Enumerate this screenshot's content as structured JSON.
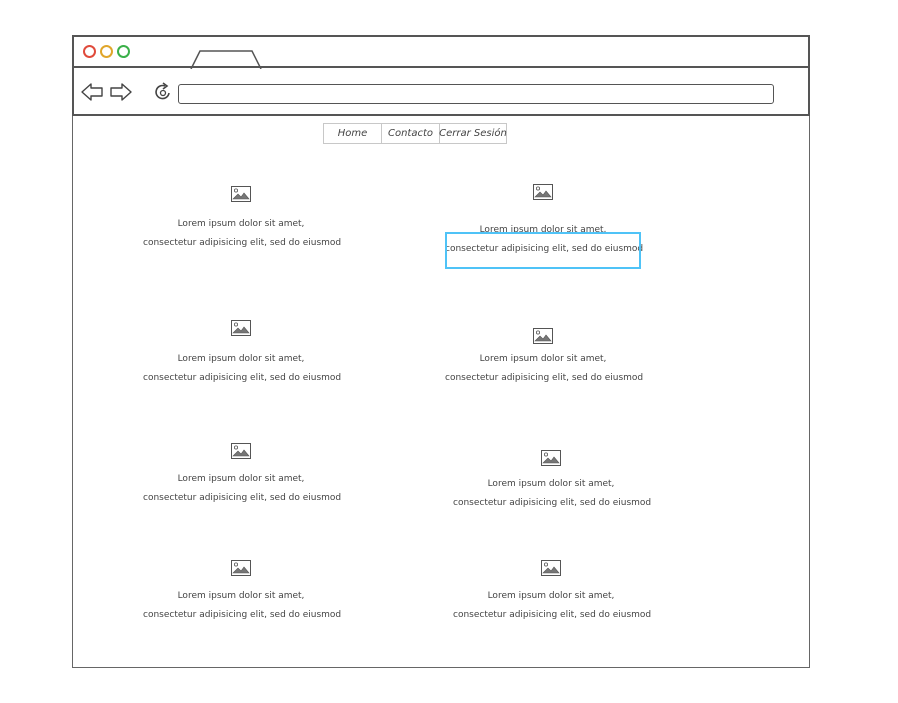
{
  "menu": {
    "items": [
      {
        "label": "Home"
      },
      {
        "label": "Contacto"
      },
      {
        "label": "Cerrar Sesión"
      }
    ]
  },
  "grid": {
    "items": [
      {
        "line1": "Lorem ipsum dolor sit amet,",
        "line2": "consectetur adipisicing elit, sed do eiusmod"
      },
      {
        "line1": "Lorem ipsum dolor sit amet,",
        "line2": "consectetur adipisicing elit, sed do eiusmod",
        "selected": true
      },
      {
        "line1": "Lorem ipsum dolor sit amet,",
        "line2": "consectetur adipisicing elit, sed do eiusmod"
      },
      {
        "line1": "Lorem ipsum dolor sit amet,",
        "line2": "consectetur adipisicing elit, sed do eiusmod"
      },
      {
        "line1": "Lorem ipsum dolor sit amet,",
        "line2": "consectetur adipisicing elit, sed do eiusmod"
      },
      {
        "line1": "Lorem ipsum dolor sit amet,",
        "line2": "consectetur adipisicing elit, sed do eiusmod"
      },
      {
        "line1": "Lorem ipsum dolor sit amet,",
        "line2": "consectetur adipisicing elit, sed do eiusmod"
      },
      {
        "line1": "Lorem ipsum dolor sit amet,",
        "line2": "consectetur adipisicing elit, sed do eiusmod"
      }
    ]
  },
  "colors": {
    "close": "#e04b3c",
    "minimize": "#e0a62b",
    "maximize": "#3bb04a",
    "selection": "#4fc3f7"
  },
  "icons": {
    "image": "image-placeholder-icon",
    "back": "back-arrow-icon",
    "forward": "forward-arrow-icon",
    "reload": "reload-icon"
  }
}
